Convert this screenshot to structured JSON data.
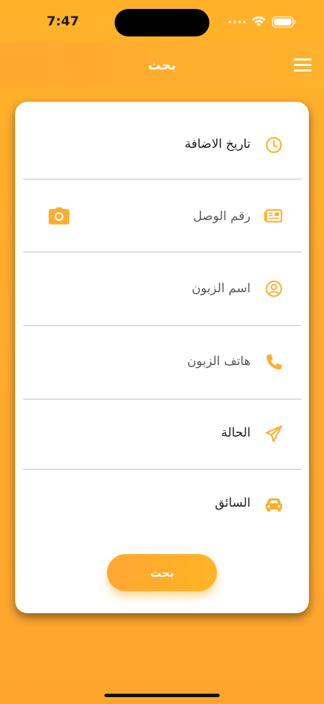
{
  "status_bar": {
    "time": "7:47"
  },
  "app_bar": {
    "title": "بحث"
  },
  "form": {
    "fields": [
      {
        "label": "تاريخ الاضافة",
        "icon": "clock-icon"
      },
      {
        "label": "رقم الوصل",
        "icon": "receipt-icon"
      },
      {
        "label": "اسم الزبون",
        "icon": "user-circle-icon"
      },
      {
        "label": "هاتف الزبون",
        "icon": "phone-icon"
      },
      {
        "label": "الحالة",
        "icon": "paper-plane-icon"
      },
      {
        "label": "السائق",
        "icon": "car-icon"
      }
    ],
    "camera_icon": "camera-icon",
    "search_label": "بحث"
  },
  "colors": {
    "accent": "#FFAE2C",
    "background": "#FFA830",
    "card": "#FFFFFF",
    "text_dark": "#1D1D1D",
    "text_muted": "#5A5A5A",
    "divider": "#BDBDBD"
  }
}
